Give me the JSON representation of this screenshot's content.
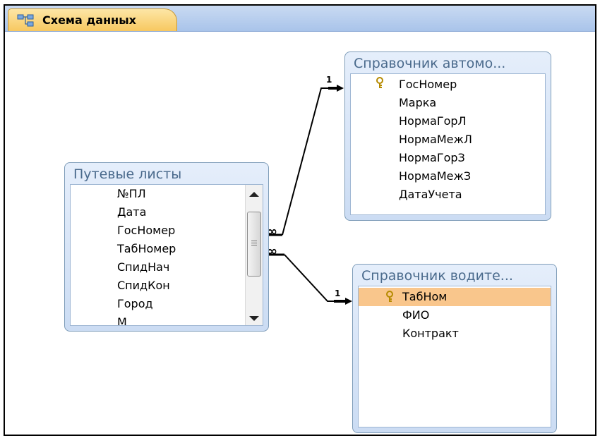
{
  "tab": {
    "label": "Схема данных",
    "icon": "relationships-icon"
  },
  "tables": {
    "trips": {
      "title": "Путевые листы",
      "fields": [
        "№ПЛ",
        "Дата",
        "ГосНомер",
        "ТабНомер",
        "СпидНач",
        "СпидКон",
        "Город",
        "М"
      ]
    },
    "cars": {
      "title": "Справочник автомо...",
      "fields": [
        "ГосНомер",
        "Марка",
        "НормаГорЛ",
        "НормаМежЛ",
        "НормаГорЗ",
        "НормаМежЗ",
        "ДатаУчета"
      ]
    },
    "drivers": {
      "title": "Справочник водите...",
      "fields": [
        "ТабНом",
        "ФИО",
        "Контракт"
      ]
    }
  },
  "relations": [
    {
      "from": "Путевые листы.ГосНомер",
      "to": "Справочник автомо....ГосНомер",
      "one_label": "1",
      "many_label": "∞"
    },
    {
      "from": "Путевые листы.ТабНомер",
      "to": "Справочник водите....ТабНом",
      "one_label": "1",
      "many_label": "∞"
    }
  ],
  "colors": {
    "tab": "#f7c860",
    "tabbar": "#a9c4ea",
    "selected_row": "#f9c68c",
    "table_title": "#4a6a8c"
  }
}
